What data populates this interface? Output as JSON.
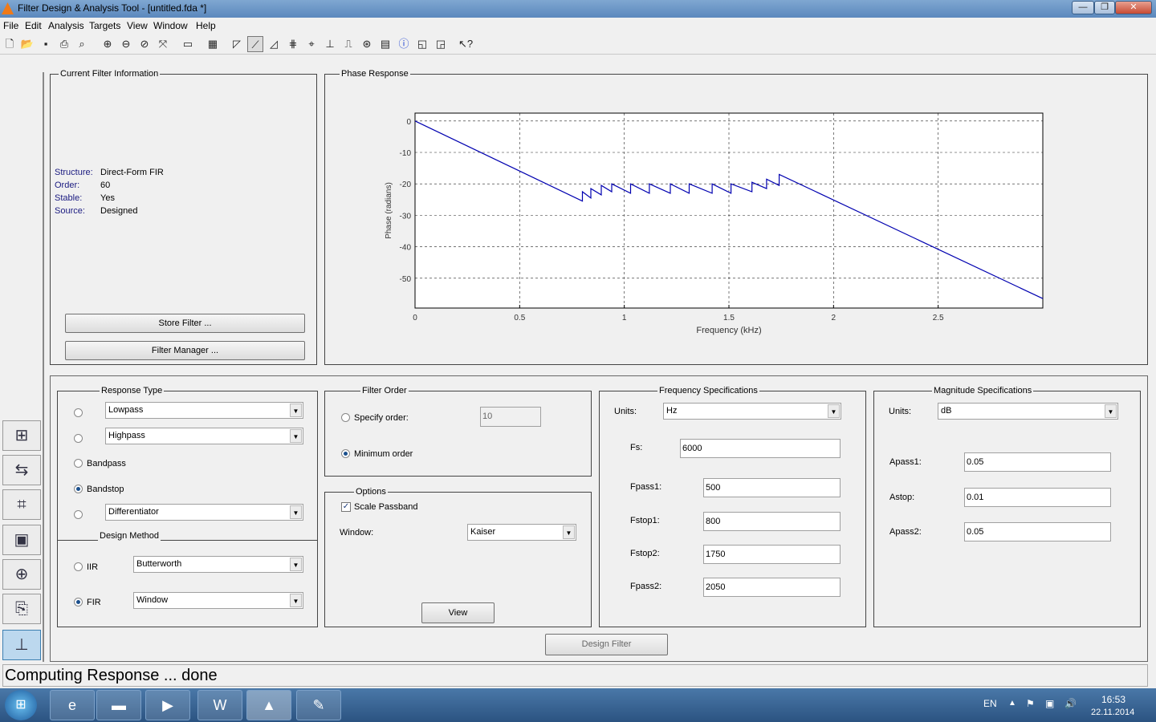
{
  "window": {
    "title": "Filter Design & Analysis Tool -  [untitled.fda *]",
    "min": "—",
    "max": "❐",
    "close": "✕"
  },
  "menu": [
    "File",
    "Edit",
    "Analysis",
    "Targets",
    "View",
    "Window",
    "Help"
  ],
  "toolbar_icons": [
    "new-icon",
    "open-icon",
    "save-icon",
    "print-icon",
    "print-preview-icon",
    "zoom-in-icon",
    "zoom-x-icon",
    "zoom-y-icon",
    "full-view-icon",
    "new-figure-icon",
    "filter-specs-icon",
    "magnitude-icon",
    "phase-icon",
    "mag-phase-icon",
    "group-delay-icon",
    "phase-delay-icon",
    "impulse-icon",
    "step-icon",
    "pole-zero-icon",
    "coefficients-icon",
    "info-icon",
    "magnitude-estimate-icon",
    "noise-icon",
    "whats-this-icon"
  ],
  "left_icons": [
    "transform-icon",
    "multirate-icon",
    "realize-model-icon",
    "quantize-icon",
    "pole-zero-editor-icon",
    "import-filter-icon",
    "design-filter-icon"
  ],
  "filter_info": {
    "title": "Current Filter Information",
    "rows": [
      {
        "k": "Structure:",
        "v": "Direct-Form FIR"
      },
      {
        "k": "Order:",
        "v": "60"
      },
      {
        "k": "Stable:",
        "v": "Yes"
      },
      {
        "k": "Source:",
        "v": "Designed"
      }
    ],
    "store": "Store Filter ...",
    "manager": "Filter Manager ..."
  },
  "chart_data": {
    "type": "line",
    "title": "Phase Response",
    "xlabel": "Frequency (kHz)",
    "ylabel": "Phase (radians)",
    "xlim": [
      0,
      3
    ],
    "ylim": [
      -59.5,
      2.5
    ],
    "xticks": [
      "0",
      "0.5",
      "1",
      "1.5",
      "2",
      "2.5"
    ],
    "xtick_vals": [
      0,
      0.5,
      1,
      1.5,
      2,
      2.5
    ],
    "yticks": [
      "0",
      "-10",
      "-20",
      "-30",
      "-40",
      "-50"
    ],
    "ytick_vals": [
      0,
      -10,
      -20,
      -30,
      -40,
      -50
    ],
    "grid": true,
    "color": "#0000b0",
    "x": [
      0,
      0.8,
      0.8,
      0.84,
      0.84,
      0.89,
      0.89,
      0.94,
      0.94,
      1.03,
      1.03,
      1.12,
      1.12,
      1.22,
      1.22,
      1.31,
      1.31,
      1.42,
      1.42,
      1.51,
      1.51,
      1.61,
      1.61,
      1.68,
      1.68,
      1.74,
      1.74,
      3
    ],
    "y": [
      0,
      -25.5,
      -22.5,
      -24.5,
      -21.5,
      -23.5,
      -20.5,
      -22.5,
      -20,
      -23,
      -20,
      -23,
      -20,
      -23,
      -20,
      -23,
      -20,
      -23,
      -20,
      -23,
      -20,
      -22.5,
      -19.5,
      -21.5,
      -18.5,
      -20.5,
      -17,
      -56.5
    ]
  },
  "response_type": {
    "title": "Response Type",
    "lowpass": "Lowpass",
    "highpass": "Highpass",
    "bandpass": "Bandpass",
    "bandstop": "Bandstop",
    "differentiator": "Differentiator"
  },
  "design_method": {
    "title": "Design Method",
    "iir": "IIR",
    "iir_value": "Butterworth",
    "fir": "FIR",
    "fir_value": "Window"
  },
  "filter_order": {
    "title": "Filter Order",
    "specify": "Specify order:",
    "specify_value": "10",
    "minimum": "Minimum order"
  },
  "options": {
    "title": "Options",
    "scale": "Scale Passband",
    "window_label": "Window:",
    "window_value": "Kaiser",
    "view": "View"
  },
  "freq": {
    "title": "Frequency Specifications",
    "units_label": "Units:",
    "units": "Hz",
    "fs_label": "Fs:",
    "fs": "6000",
    "fpass1_label": "Fpass1:",
    "fpass1": "500",
    "fstop1_label": "Fstop1:",
    "fstop1": "800",
    "fstop2_label": "Fstop2:",
    "fstop2": "1750",
    "fpass2_label": "Fpass2:",
    "fpass2": "2050"
  },
  "mag": {
    "title": "Magnitude Specifications",
    "units_label": "Units:",
    "units": "dB",
    "apass1_label": "Apass1:",
    "apass1": "0.05",
    "astop_label": "Astop:",
    "astop": "0.01",
    "apass2_label": "Apass2:",
    "apass2": "0.05"
  },
  "design_button": "Design Filter",
  "status": "Computing Response ... done",
  "taskbar": {
    "lang": "EN",
    "time": "16:53",
    "date": "22.11.2014",
    "apps": [
      "ie-icon",
      "explorer-icon",
      "media-player-icon",
      "word-icon",
      "matlab-icon",
      "paint-icon"
    ]
  }
}
